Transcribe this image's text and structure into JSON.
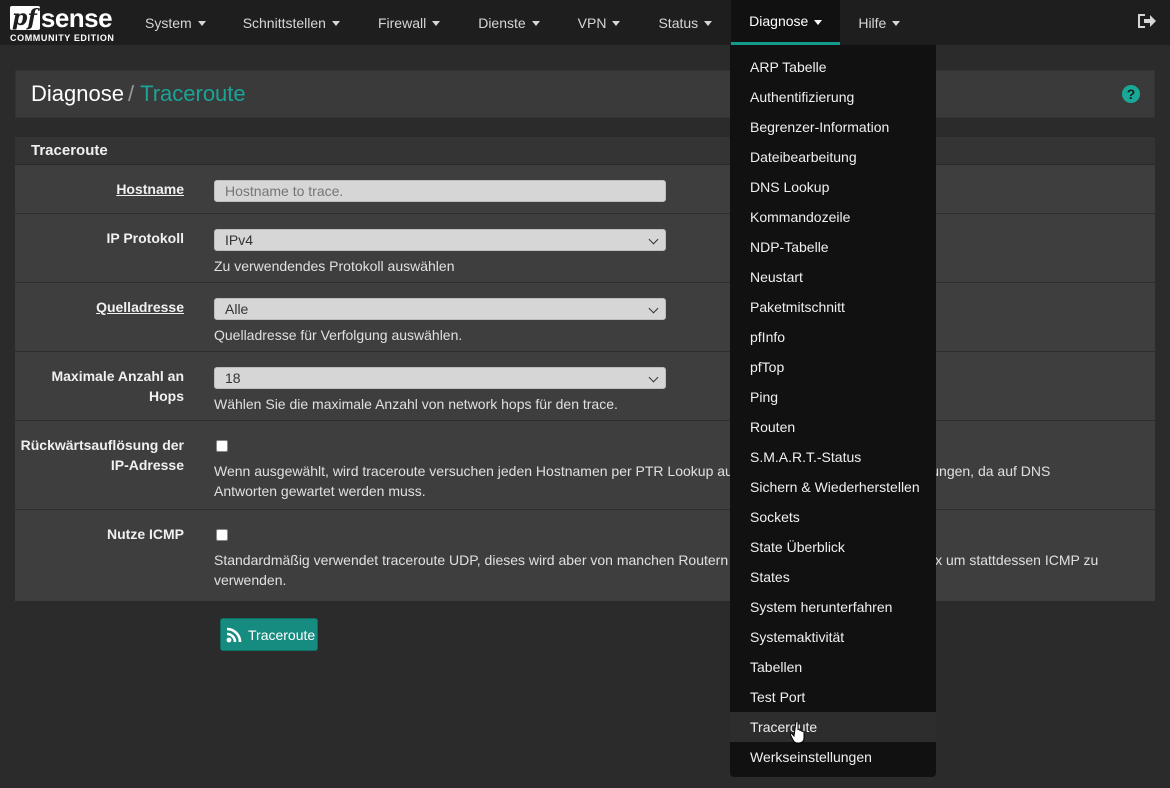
{
  "brand": {
    "logo_main": "pf",
    "logo_suffix": "sense",
    "edition": "COMMUNITY EDITION"
  },
  "nav": {
    "items": [
      {
        "label": "System"
      },
      {
        "label": "Schnittstellen"
      },
      {
        "label": "Firewall"
      },
      {
        "label": "Dienste"
      },
      {
        "label": "VPN"
      },
      {
        "label": "Status"
      },
      {
        "label": "Diagnose",
        "active": true
      },
      {
        "label": "Hilfe"
      }
    ],
    "logout_icon": "sign-out-icon"
  },
  "breadcrumb": {
    "root": "Diagnose",
    "separator": "/",
    "current": "Traceroute",
    "help_icon": "question-circle-icon"
  },
  "panel": {
    "title": "Traceroute",
    "rows": {
      "hostname": {
        "label": "Hostname",
        "placeholder": "Hostname to trace."
      },
      "ip_protocol": {
        "label": "IP Protokoll",
        "value": "IPv4",
        "help": "Zu verwendendes Protokoll auswählen"
      },
      "source": {
        "label": "Quelladresse",
        "value": "Alle",
        "help": "Quelladresse für Verfolgung auswählen."
      },
      "max_hops": {
        "label_line1": "Maximale Anzahl an",
        "label_line2": "Hops",
        "value": "18",
        "help": "Wählen Sie die maximale Anzahl von network hops für den trace."
      },
      "reverse": {
        "label_line1": "Rückwärtsauflösung der",
        "label_line2": "IP-Adresse",
        "checked": false,
        "help": "Wenn ausgewählt, wird traceroute versuchen jeden Hostnamen per PTR Lookup aufzulösen. Dies führt zu Verzögerungen, da auf DNS Antworten gewartet werden muss."
      },
      "icmp": {
        "label": "Nutze ICMP",
        "checked": false,
        "help": "Standardmäßig verwendet traceroute UDP, dieses wird aber von manchen Routern geblockt. Aktivieren Sie diese Box um stattdessen ICMP zu verwenden."
      }
    },
    "button": {
      "label": "Traceroute",
      "icon": "rss-icon"
    }
  },
  "dropdown": {
    "items": [
      "ARP Tabelle",
      "Authentifizierung",
      "Begrenzer-Information",
      "Dateibearbeitung",
      "DNS Lookup",
      "Kommandozeile",
      "NDP-Tabelle",
      "Neustart",
      "Paketmitschnitt",
      "pfInfo",
      "pfTop",
      "Ping",
      "Routen",
      "S.M.A.R.T.-Status",
      "Sichern & Wiederherstellen",
      "Sockets",
      "State Überblick",
      "States",
      "System herunterfahren",
      "Systemaktivität",
      "Tabellen",
      "Test Port",
      "Traceroute",
      "Werkseinstellungen"
    ],
    "hovered": "Traceroute"
  },
  "colors": {
    "accent": "#129b8c",
    "navbar": "#1e1e1e",
    "background": "#2b2b2b",
    "panel": "#3e3e3e"
  }
}
